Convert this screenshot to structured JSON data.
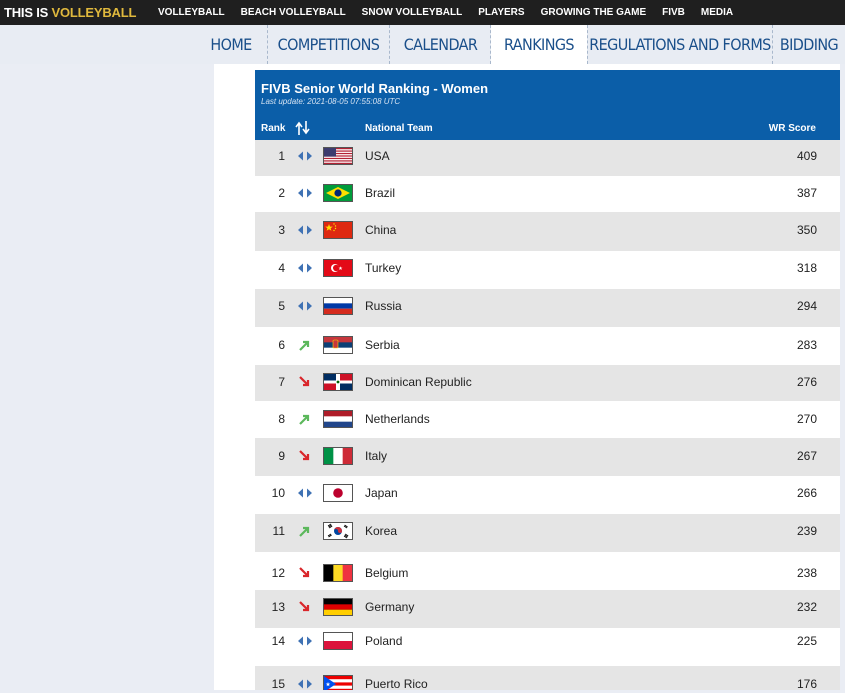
{
  "brand": {
    "prefix": "THIS IS ",
    "name": "VOLLEYBALL"
  },
  "top_nav": [
    "VOLLEYBALL",
    "BEACH VOLLEYBALL",
    "SNOW VOLLEYBALL",
    "PLAYERS",
    "GROWING THE GAME",
    "FIVB",
    "MEDIA"
  ],
  "main_nav": [
    {
      "label": "HOME",
      "active": false
    },
    {
      "label": "COMPETITIONS",
      "active": false
    },
    {
      "label": "CALENDAR",
      "active": false
    },
    {
      "label": "RANKINGS",
      "active": true
    },
    {
      "label": "REGULATIONS AND FORMS",
      "active": false
    },
    {
      "label": "BIDDING",
      "active": false
    }
  ],
  "ranking": {
    "title": "FIVB Senior World Ranking - Women",
    "last_update": "Last update: 2021-08-05 07:55:08 UTC",
    "headers": {
      "rank": "Rank",
      "team": "National Team",
      "score": "WR Score"
    },
    "rows": [
      {
        "rank": "1",
        "trend": "same",
        "flag": "usa-flag",
        "team": "USA",
        "score": "409"
      },
      {
        "rank": "2",
        "trend": "same",
        "flag": "brazil-flag",
        "team": "Brazil",
        "score": "387"
      },
      {
        "rank": "3",
        "trend": "same",
        "flag": "china-flag",
        "team": "China",
        "score": "350"
      },
      {
        "rank": "4",
        "trend": "same",
        "flag": "turkey-flag",
        "team": "Turkey",
        "score": "318"
      },
      {
        "rank": "5",
        "trend": "same",
        "flag": "russia-flag",
        "team": "Russia",
        "score": "294"
      },
      {
        "rank": "6",
        "trend": "up",
        "flag": "serbia-flag",
        "team": "Serbia",
        "score": "283"
      },
      {
        "rank": "7",
        "trend": "down",
        "flag": "dominican-republic-flag",
        "team": "Dominican Republic",
        "score": "276"
      },
      {
        "rank": "8",
        "trend": "up",
        "flag": "netherlands-flag",
        "team": "Netherlands",
        "score": "270"
      },
      {
        "rank": "9",
        "trend": "down",
        "flag": "italy-flag",
        "team": "Italy",
        "score": "267"
      },
      {
        "rank": "10",
        "trend": "same",
        "flag": "japan-flag",
        "team": "Japan",
        "score": "266"
      },
      {
        "rank": "11",
        "trend": "up",
        "flag": "korea-flag",
        "team": "Korea",
        "score": "239"
      },
      {
        "rank": "12",
        "trend": "down",
        "flag": "belgium-flag",
        "team": "Belgium",
        "score": "238"
      },
      {
        "rank": "13",
        "trend": "down",
        "flag": "germany-flag",
        "team": "Germany",
        "score": "232"
      },
      {
        "rank": "14",
        "trend": "same",
        "flag": "poland-flag",
        "team": "Poland",
        "score": "225"
      },
      {
        "rank": "15",
        "trend": "same",
        "flag": "puerto-rico-flag",
        "team": "Puerto Rico",
        "score": "176"
      }
    ]
  },
  "colors": {
    "header_blue": "#0b5ea8",
    "nav_text": "#1a4f8a",
    "trend_same": "#3f72b4",
    "trend_up": "#5cb85c",
    "trend_down": "#d9262b",
    "row_odd": "#e5e5e5"
  }
}
